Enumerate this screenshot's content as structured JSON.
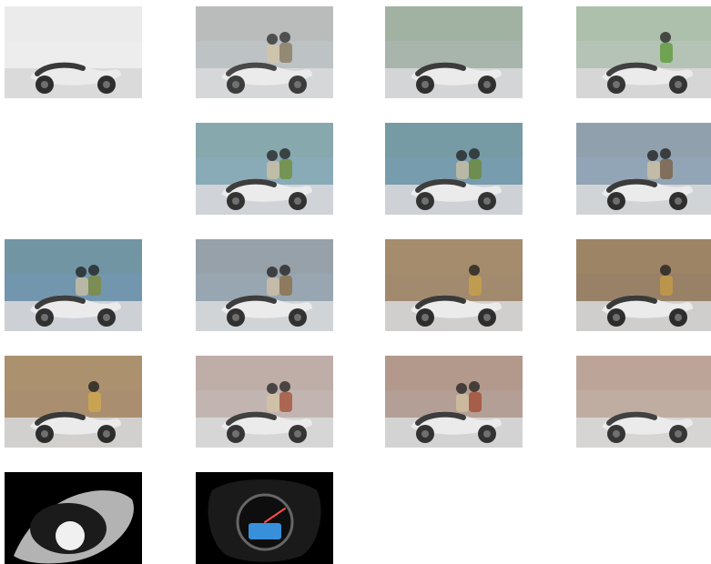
{
  "gallery": {
    "columns": 4,
    "thumbnails": [
      {
        "row": 0,
        "col": 0,
        "scene": "scooter-side-closeup",
        "palette": {
          "bg": "#f2f2f2",
          "a": "#1a1a1a",
          "b": "#d9d9d9"
        }
      },
      {
        "row": 0,
        "col": 1,
        "scene": "couple-with-scooter-city",
        "palette": {
          "bg": "#c9d2d9",
          "a": "#2b2b2b",
          "b": "#8a7a62"
        }
      },
      {
        "row": 0,
        "col": 2,
        "scene": "scooter-parked-plaza",
        "palette": {
          "bg": "#b7bfc6",
          "a": "#1d1d1d",
          "b": "#5f8a3a"
        }
      },
      {
        "row": 0,
        "col": 3,
        "scene": "people-and-scooter-park",
        "palette": {
          "bg": "#c7ccd0",
          "a": "#222222",
          "b": "#5f9a3c"
        }
      },
      {
        "row": 1,
        "col": 1,
        "scene": "riders-street-trees",
        "palette": {
          "bg": "#8fb1d2",
          "a": "#202020",
          "b": "#6f8f3c"
        }
      },
      {
        "row": 1,
        "col": 2,
        "scene": "riders-street-trees",
        "palette": {
          "bg": "#7aa0c8",
          "a": "#202020",
          "b": "#6b8a3a"
        }
      },
      {
        "row": 1,
        "col": 3,
        "scene": "riders-closeup-trees",
        "palette": {
          "bg": "#98b4cf",
          "a": "#1c1c1c",
          "b": "#7a6246"
        }
      },
      {
        "row": 2,
        "col": 0,
        "scene": "riders-glass-building",
        "palette": {
          "bg": "#6f99c6",
          "a": "#1e1e1e",
          "b": "#7d8b3e"
        }
      },
      {
        "row": 2,
        "col": 1,
        "scene": "riders-tilted-city",
        "palette": {
          "bg": "#9bb2c8",
          "a": "#1f1f1f",
          "b": "#8c6f4a"
        }
      },
      {
        "row": 2,
        "col": 2,
        "scene": "cafe-scooter-arcade",
        "palette": {
          "bg": "#9a8677",
          "a": "#1b1b1b",
          "b": "#c8a04a"
        }
      },
      {
        "row": 2,
        "col": 3,
        "scene": "cafe-scooter-tilted",
        "palette": {
          "bg": "#8f7c6e",
          "a": "#1b1b1b",
          "b": "#c49a46"
        }
      },
      {
        "row": 3,
        "col": 0,
        "scene": "cafe-scooter-closeup",
        "palette": {
          "bg": "#a08a78",
          "a": "#1a1a1a",
          "b": "#d0a84e"
        }
      },
      {
        "row": 3,
        "col": 1,
        "scene": "riders-brick-piazza",
        "palette": {
          "bg": "#c8cbcc",
          "a": "#222222",
          "b": "#a5543a"
        }
      },
      {
        "row": 3,
        "col": 2,
        "scene": "riders-brick-facade",
        "palette": {
          "bg": "#b8b1aa",
          "a": "#1f1f1f",
          "b": "#a24e35"
        }
      },
      {
        "row": 3,
        "col": 3,
        "scene": "rider-facade-front",
        "palette": {
          "bg": "#c7c2bb",
          "a": "#232323",
          "b": "#9f4d34"
        }
      },
      {
        "row": 4,
        "col": 0,
        "scene": "under-seat-storage-helmet",
        "palette": {
          "bg": "#000000",
          "a": "#e6e6e6",
          "b": "#7b7b7b"
        }
      },
      {
        "row": 4,
        "col": 1,
        "scene": "instrument-cluster",
        "palette": {
          "bg": "#000000",
          "a": "#2a2a2a",
          "b": "#3fa7ff"
        }
      }
    ]
  }
}
